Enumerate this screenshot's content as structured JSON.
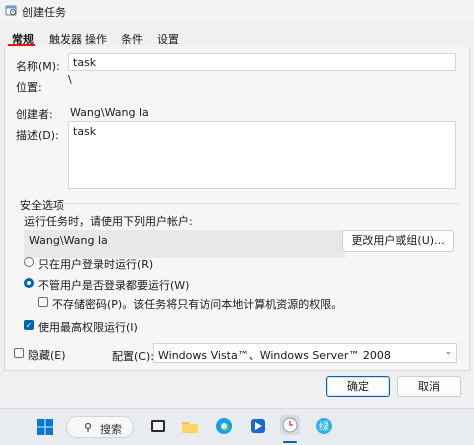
{
  "window": {
    "title": "创建任务"
  },
  "tabs": [
    {
      "label": "常规",
      "active": true
    },
    {
      "label": "触发器"
    },
    {
      "label": "操作"
    },
    {
      "label": "条件"
    },
    {
      "label": "设置"
    }
  ],
  "general": {
    "name_label": "名称(M):",
    "name_value": "task",
    "location_label": "位置:",
    "location_value": "\\",
    "author_label": "创建者:",
    "author_value": "Wang\\Wang la",
    "description_label": "描述(D):",
    "description_value": "task"
  },
  "security": {
    "group_title": "安全选项",
    "run_as_label": "运行任务时，请使用下列用户帐户:",
    "user_account": "Wang\\Wang la",
    "change_user_button": "更改用户或组(U)...",
    "radio_logged_on": "只在用户登录时运行(R)",
    "radio_whether": "不管用户是否登录都要运行(W)",
    "selected_radio": "whether",
    "no_password_label": "不存储密码(P)。该任务将只有访问本地计算机资源的权限。",
    "no_password_checked": false,
    "highest_privileges_label": "使用最高权限运行(I)",
    "highest_privileges_checked": true
  },
  "bottom": {
    "hidden_label": "隐藏(E)",
    "hidden_checked": false,
    "configure_label": "配置(C):",
    "configure_value": "Windows Vista™、Windows Server™ 2008",
    "ok_button": "确定",
    "cancel_button": "取消"
  },
  "taskbar": {
    "search_text": "搜索",
    "icons": [
      "start-icon",
      "search-icon",
      "task-view-icon",
      "file-explorer-icon",
      "edge-icon",
      "app-icon",
      "clock-app-icon",
      "app-icon"
    ]
  },
  "colors": {
    "accent": "#0063b1",
    "active_tab_underline": "#e11111",
    "background": "#f0f0f0"
  }
}
